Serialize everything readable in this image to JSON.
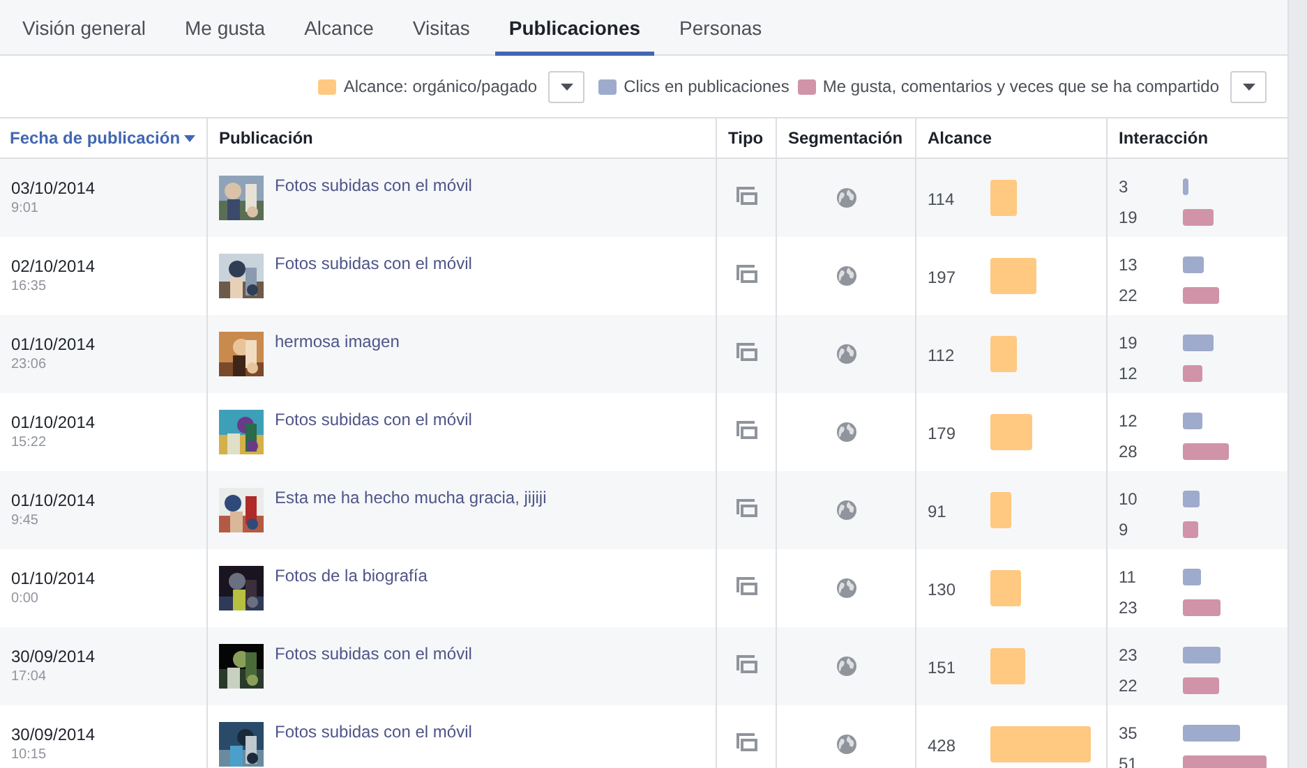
{
  "tabs": [
    {
      "label": "Visión general",
      "selected": false
    },
    {
      "label": "Me gusta",
      "selected": false
    },
    {
      "label": "Alcance",
      "selected": false
    },
    {
      "label": "Visitas",
      "selected": false
    },
    {
      "label": "Publicaciones",
      "selected": true
    },
    {
      "label": "Personas",
      "selected": false
    }
  ],
  "legend": [
    {
      "label": "Alcance: orgánico/pagado",
      "color": "#ffc982",
      "dropdown": true
    },
    {
      "label": "Clics en publicaciones",
      "color": "#9eabcc",
      "dropdown": false
    },
    {
      "label": "Me gusta, comentarios y veces que se ha compartido",
      "color": "#d193a8",
      "dropdown": true
    }
  ],
  "table": {
    "columns": [
      {
        "label": "Fecha de publicación",
        "sorted": true
      },
      {
        "label": "Publicación",
        "sorted": false
      },
      {
        "label": "Tipo",
        "sorted": false
      },
      {
        "label": "Segmentación",
        "sorted": false
      },
      {
        "label": "Alcance",
        "sorted": false
      },
      {
        "label": "Interacción",
        "sorted": false
      }
    ],
    "rows": [
      {
        "date": "03/10/2014",
        "time": "9:01",
        "title": "Fotos subidas con el móvil",
        "reach": "114",
        "clicks": "3",
        "engagement": "19"
      },
      {
        "date": "02/10/2014",
        "time": "16:35",
        "title": "Fotos subidas con el móvil",
        "reach": "197",
        "clicks": "13",
        "engagement": "22"
      },
      {
        "date": "01/10/2014",
        "time": "23:06",
        "title": "hermosa imagen",
        "reach": "112",
        "clicks": "19",
        "engagement": "12"
      },
      {
        "date": "01/10/2014",
        "time": "15:22",
        "title": "Fotos subidas con el móvil",
        "reach": "179",
        "clicks": "12",
        "engagement": "28"
      },
      {
        "date": "01/10/2014",
        "time": "9:45",
        "title": "Esta me ha hecho mucha gracia, jijiji",
        "reach": "91",
        "clicks": "10",
        "engagement": "9"
      },
      {
        "date": "01/10/2014",
        "time": "0:00",
        "title": "Fotos de la biografía",
        "reach": "130",
        "clicks": "11",
        "engagement": "23"
      },
      {
        "date": "30/09/2014",
        "time": "17:04",
        "title": "Fotos subidas con el móvil",
        "reach": "151",
        "clicks": "23",
        "engagement": "22"
      },
      {
        "date": "30/09/2014",
        "time": "10:15",
        "title": "Fotos subidas con el móvil",
        "reach": "428",
        "clicks": "35",
        "engagement": "51"
      }
    ]
  }
}
